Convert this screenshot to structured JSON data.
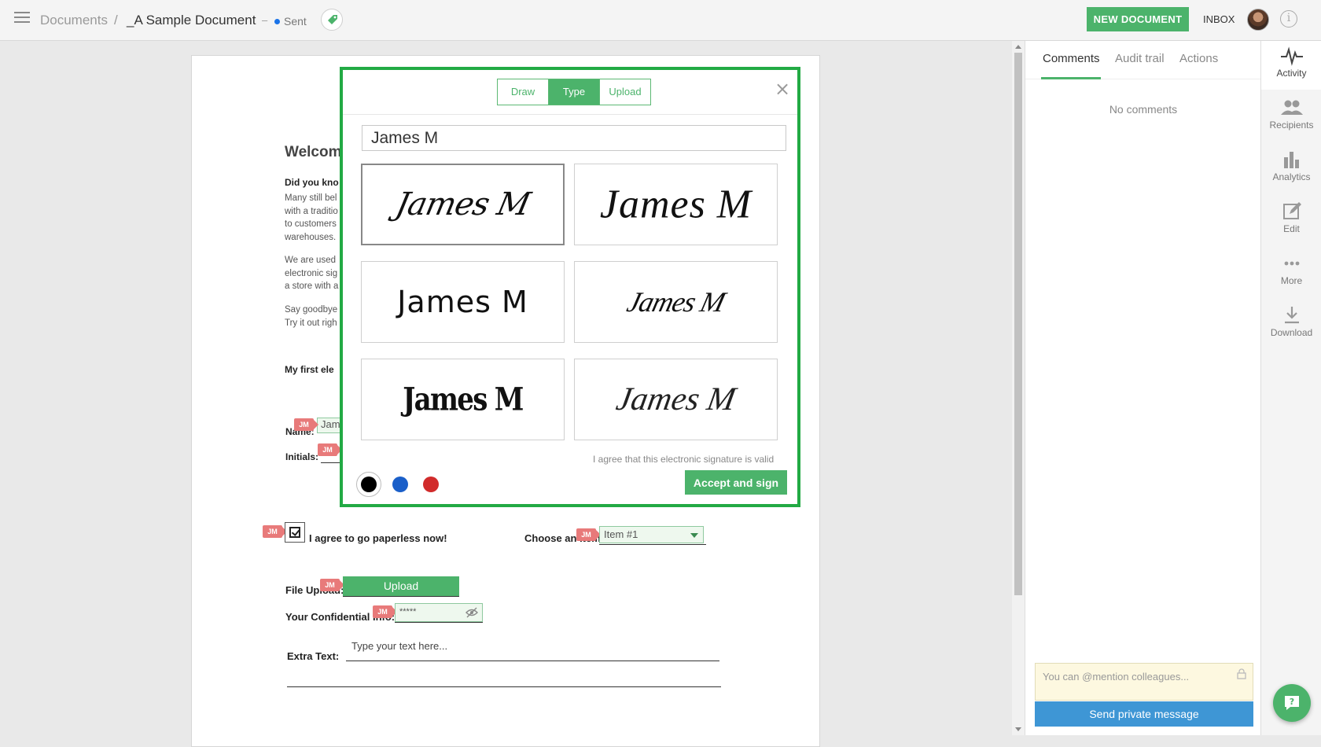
{
  "topbar": {
    "breadcrumb_root": "Documents",
    "breadcrumb_sep": "/",
    "document_title": "_A Sample Document",
    "status_dash": "–",
    "status": "Sent",
    "new_document": "NEW DOCUMENT",
    "inbox": "INBOX",
    "info": "i"
  },
  "document": {
    "heading": "Welcom",
    "subheading": "Did you kno",
    "paragraph1": [
      "Many still bel",
      "with a traditio",
      "to customers",
      "warehouses."
    ],
    "paragraph2": [
      "We are used",
      "electronic sig",
      "a store with a"
    ],
    "paragraph3": [
      "Say goodbye",
      "Try it out righ"
    ],
    "my_first": "My first ele",
    "name_label": "Name:",
    "name_value": "Jam",
    "initials_label": "Initials:",
    "checkbox_label": "I agree to go paperless now!",
    "choose_label": "Choose an Item:",
    "choose_value": "Item #1",
    "file_upload_label": "File Upload:",
    "upload_button": "Upload",
    "confidential_label": "Your Confidential Info:",
    "confidential_value": "*****",
    "extra_text_label": "Extra Text:",
    "extra_text_placeholder": "Type your text here...",
    "recipient_tag": "JM"
  },
  "signature_modal": {
    "tabs": [
      "Draw",
      "Type",
      "Upload"
    ],
    "active_tab": "Type",
    "close": "×",
    "name_input_value": "James M",
    "signature_options": [
      "James M",
      "James M",
      "James M",
      "James M",
      "James M",
      "James M"
    ],
    "selected_index": 0,
    "agreement": "I agree that this electronic signature is valid",
    "colors": [
      "#000000",
      "#1a5fc9",
      "#d12b2b"
    ],
    "selected_color": "#000000",
    "accept_button": "Accept and sign"
  },
  "right_panel": {
    "tabs": [
      "Comments",
      "Audit trail",
      "Actions"
    ],
    "active_tab": "Comments",
    "empty_state": "No comments",
    "mention_placeholder": "You can @mention colleagues...",
    "send_button": "Send private message"
  },
  "sidebar": {
    "items": [
      "Activity",
      "Recipients",
      "Analytics",
      "Edit",
      "More",
      "Download"
    ],
    "active": "Activity"
  },
  "colors": {
    "accent_green": "#4cb36b",
    "modal_border": "#22aa44",
    "send_blue": "#3e96d5",
    "tag_red": "#e87a7a",
    "status_blue": "#1a73e8"
  }
}
